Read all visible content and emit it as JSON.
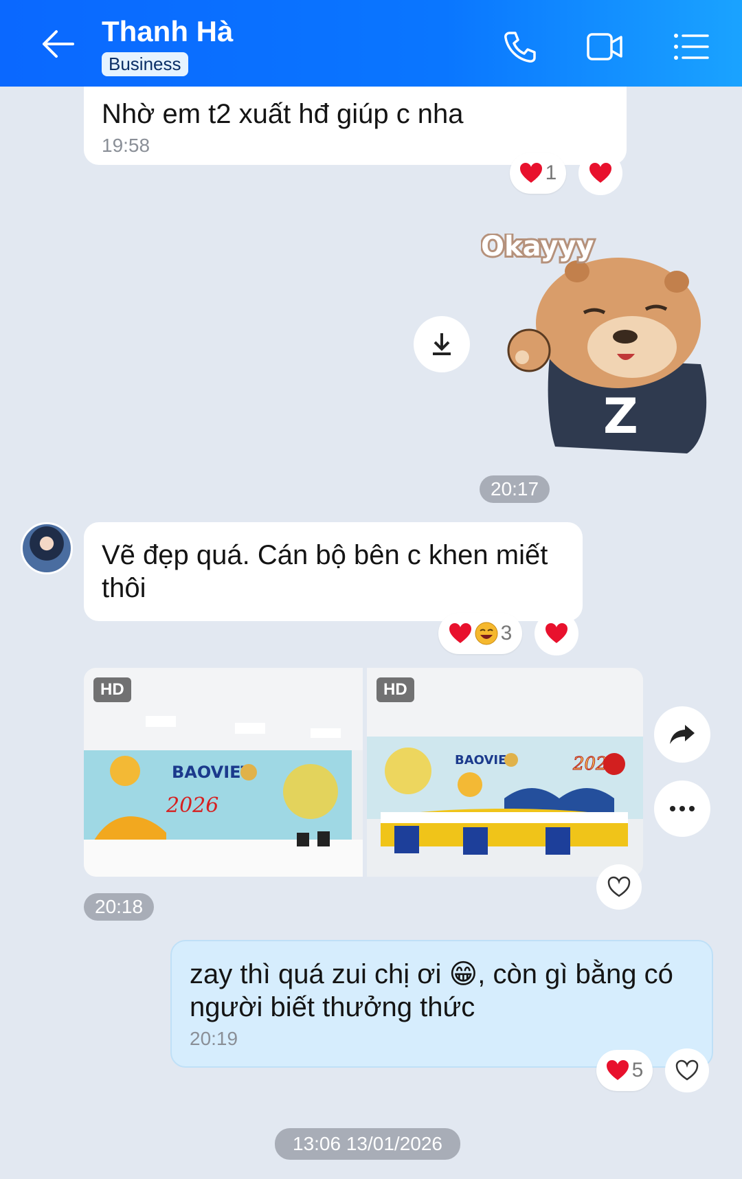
{
  "header": {
    "title": "Thanh Hà",
    "badge": "Business"
  },
  "messages": {
    "m1": {
      "text": "Nhờ em t2 xuất hđ giúp c nha",
      "time": "19:58",
      "reaction_count": "1"
    },
    "sticker": {
      "text": "Okayyy",
      "time": "20:17"
    },
    "m2": {
      "text": "Vẽ đẹp quá. Cán bộ bên c khen miết thôi",
      "reaction_count": "3"
    },
    "photos": {
      "hd1": "HD",
      "hd2": "HD",
      "time": "20:18"
    },
    "m3": {
      "text_a": "zay thì quá zui chị ơi",
      "emoji": "😁",
      "text_b": ", còn gì bằng có người biết thưởng thức",
      "time": "20:19",
      "reaction_count": "5"
    },
    "date_separator": "13:06 13/01/2026"
  },
  "colors": {
    "header": "#0a6cff",
    "heart": "#e8112d",
    "my_bubble": "#d6edfd"
  }
}
